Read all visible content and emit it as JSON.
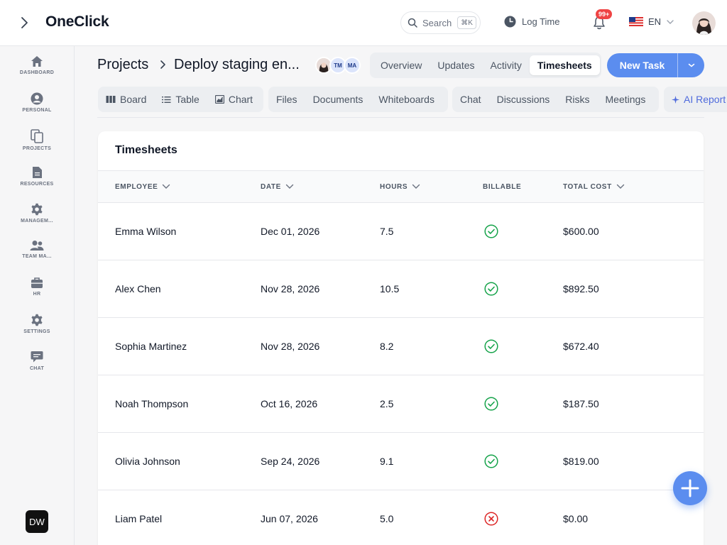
{
  "app": {
    "brand": "OneClick"
  },
  "topbar": {
    "search_label": "Search",
    "search_shortcut": "⌘K",
    "log_time_label": "Log Time",
    "notifications_badge": "99+",
    "language": "EN"
  },
  "sidebar": {
    "items": [
      {
        "label": "DASHBOARD",
        "icon": "home-icon"
      },
      {
        "label": "PERSONAL",
        "icon": "user-circle-icon"
      },
      {
        "label": "PROJECTS",
        "icon": "copy-icon"
      },
      {
        "label": "RESOURCES",
        "icon": "file-icon"
      },
      {
        "label": "MANAGEM...",
        "icon": "gear-icon"
      },
      {
        "label": "TEAM MA...",
        "icon": "team-icon"
      },
      {
        "label": "HR",
        "icon": "briefcase-icon"
      },
      {
        "label": "SETTINGS",
        "icon": "gear-icon"
      },
      {
        "label": "CHAT",
        "icon": "chat-icon"
      }
    ],
    "user_initials": "DW"
  },
  "header": {
    "breadcrumb_root": "Projects",
    "breadcrumb_current": "Deploy staging en...",
    "members": [
      "TM",
      "MA"
    ],
    "view_tabs": [
      {
        "label": "Overview",
        "active": false
      },
      {
        "label": "Updates",
        "active": false
      },
      {
        "label": "Activity",
        "active": false
      },
      {
        "label": "Timesheets",
        "active": true
      }
    ],
    "new_task_label": "New Task"
  },
  "toolbar": {
    "views": [
      "Board",
      "Table",
      "Chart"
    ],
    "docs": [
      "Files",
      "Documents",
      "Whiteboards"
    ],
    "collab": [
      "Chat",
      "Discussions",
      "Risks",
      "Meetings"
    ],
    "ai_label": "AI Report"
  },
  "timesheets": {
    "title": "Timesheets",
    "columns": [
      "EMPLOYEE",
      "DATE",
      "HOURS",
      "BILLABLE",
      "TOTAL COST"
    ],
    "rows": [
      {
        "employee": "Emma Wilson",
        "date": "Dec 01, 2026",
        "hours": "7.5",
        "billable": true,
        "total_cost": "$600.00"
      },
      {
        "employee": "Alex Chen",
        "date": "Nov 28, 2026",
        "hours": "10.5",
        "billable": true,
        "total_cost": "$892.50"
      },
      {
        "employee": "Sophia Martinez",
        "date": "Nov 28, 2026",
        "hours": "8.2",
        "billable": true,
        "total_cost": "$672.40"
      },
      {
        "employee": "Noah Thompson",
        "date": "Oct 16, 2026",
        "hours": "2.5",
        "billable": true,
        "total_cost": "$187.50"
      },
      {
        "employee": "Olivia Johnson",
        "date": "Sep 24, 2026",
        "hours": "9.1",
        "billable": true,
        "total_cost": "$819.00"
      },
      {
        "employee": "Liam Patel",
        "date": "Jun 07, 2026",
        "hours": "5.0",
        "billable": false,
        "total_cost": "$0.00"
      }
    ]
  },
  "colors": {
    "accent": "#5b8def",
    "billable_yes": "#16a34a",
    "billable_no": "#dc2626"
  }
}
